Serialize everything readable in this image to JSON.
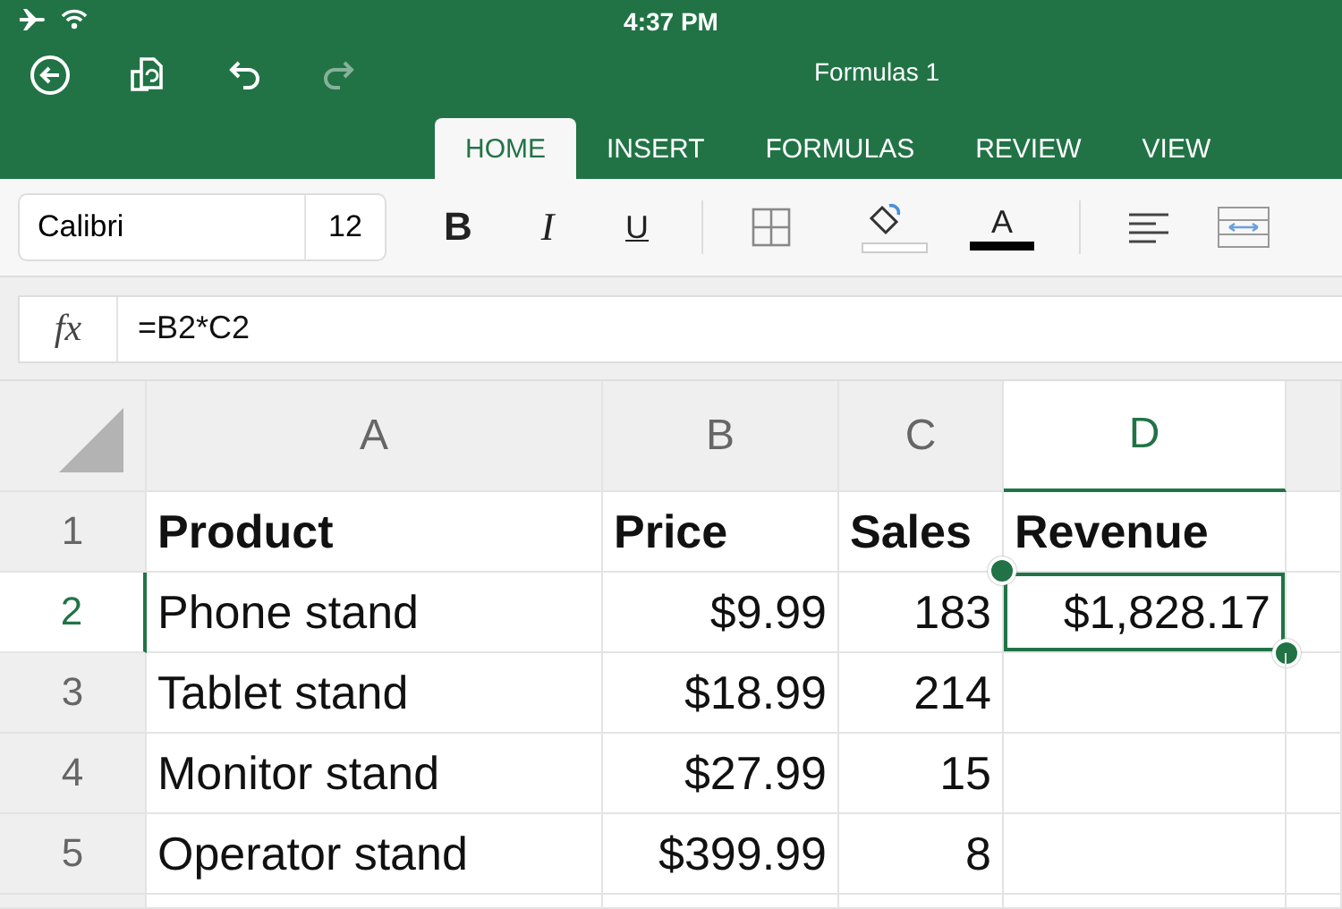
{
  "status_bar": {
    "time": "4:37 PM"
  },
  "toolbar": {
    "title": "Formulas 1",
    "buttons": [
      {
        "kind": "back",
        "disabled": false
      },
      {
        "kind": "files",
        "disabled": false
      },
      {
        "kind": "undo",
        "disabled": false
      },
      {
        "kind": "redo",
        "disabled": true
      }
    ]
  },
  "tabs": [
    {
      "label": "HOME",
      "selected": true
    },
    {
      "label": "INSERT",
      "selected": false
    },
    {
      "label": "FORMULAS",
      "selected": false
    },
    {
      "label": "REVIEW",
      "selected": false
    },
    {
      "label": "VIEW",
      "selected": false
    }
  ],
  "ribbon": {
    "font": "Calibri",
    "size": "12",
    "bold": "B",
    "italic": "I",
    "underline": "U",
    "font_color": "A"
  },
  "formula_bar": {
    "label": "fx",
    "formula": "=B2*C2"
  },
  "columns": [
    {
      "label": "A",
      "kind": "text",
      "selected": false
    },
    {
      "label": "B",
      "kind": "number",
      "selected": false
    },
    {
      "label": "C",
      "kind": "number",
      "selected": false
    },
    {
      "label": "D",
      "kind": "number",
      "selected": true
    }
  ],
  "rows": [
    {
      "number": "1",
      "kind": "header",
      "selected": false,
      "cells": [
        "Product",
        "Price",
        "Sales",
        "Revenue"
      ]
    },
    {
      "number": "2",
      "kind": "data",
      "selected": true,
      "cells": [
        "Phone stand",
        "$9.99",
        "183",
        "$1,828.17"
      ]
    },
    {
      "number": "3",
      "kind": "data",
      "selected": false,
      "cells": [
        "Tablet stand",
        "$18.99",
        "214"
      ]
    },
    {
      "number": "4",
      "kind": "data",
      "selected": false,
      "cells": [
        "Monitor stand",
        "$27.99",
        "15"
      ]
    },
    {
      "number": "5",
      "kind": "data",
      "selected": false,
      "cells": [
        "Operator stand",
        "$399.99",
        "8"
      ]
    }
  ]
}
